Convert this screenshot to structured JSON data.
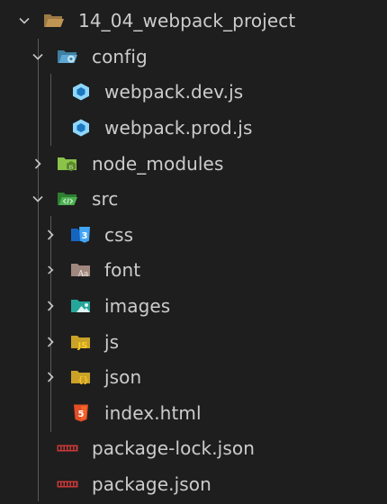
{
  "explorer": {
    "root": {
      "label": "14_04_webpack_project",
      "icon": "folder-open-icon",
      "expanded": true
    },
    "config": {
      "label": "config",
      "icon": "config-folder-icon",
      "expanded": true
    },
    "webpack_dev": {
      "label": "webpack.dev.js",
      "icon": "webpack-icon"
    },
    "webpack_prod": {
      "label": "webpack.prod.js",
      "icon": "webpack-icon"
    },
    "node_modules": {
      "label": "node_modules",
      "icon": "node-folder-icon",
      "expanded": false
    },
    "src": {
      "label": "src",
      "icon": "src-folder-icon",
      "expanded": true
    },
    "css": {
      "label": "css",
      "icon": "css3-icon",
      "expanded": false
    },
    "font": {
      "label": "font",
      "icon": "font-folder-icon",
      "expanded": false
    },
    "images": {
      "label": "images",
      "icon": "images-folder-icon",
      "expanded": false
    },
    "js": {
      "label": "js",
      "icon": "js-folder-icon",
      "expanded": false
    },
    "json": {
      "label": "json",
      "icon": "json-folder-icon",
      "expanded": false
    },
    "index_html": {
      "label": "index.html",
      "icon": "html5-icon"
    },
    "package_lock": {
      "label": "package-lock.json",
      "icon": "npm-icon"
    },
    "package_json": {
      "label": "package.json",
      "icon": "npm-icon"
    }
  },
  "colors": {
    "background": "#1e1e1e",
    "text": "#cccccc",
    "chevron": "#c5c5c5",
    "guide": "#585858",
    "folder_tan": "#c09553",
    "webpack_blue": "#8ed6fb",
    "node_green": "#8bc34a",
    "src_green": "#4caf50",
    "css_blue": "#42a5f5",
    "font_brown": "#a1887f",
    "images_teal": "#26a69a",
    "js_yellow": "#ffca28",
    "json_yellow": "#fbc02d",
    "html_orange": "#e44d26",
    "npm_red": "#cb3837"
  }
}
